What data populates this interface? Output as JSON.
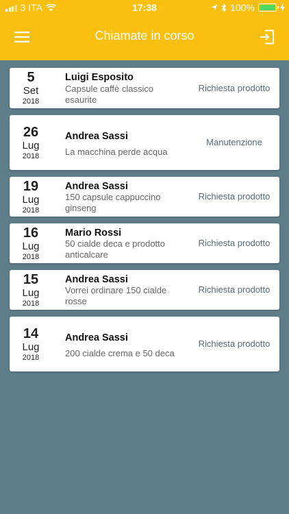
{
  "status_bar": {
    "carrier": "3 ITA",
    "time": "17:38",
    "battery": "100%"
  },
  "header": {
    "title": "Chiamate in corso",
    "menu_icon": "hamburger-menu-icon",
    "logout_icon": "logout-icon"
  },
  "colors": {
    "header": "#fbbf10",
    "background": "#5f7c89",
    "card": "#ffffff",
    "battery": "#4cd964"
  },
  "calls": [
    {
      "day": "5",
      "month": "Set",
      "year": "2018",
      "name": "Luigi Esposito",
      "description": "Capsule caffè classico esaurite",
      "type": "Richiesta prodotto"
    },
    {
      "day": "26",
      "month": "Lug",
      "year": "2018",
      "name": "Andrea Sassi",
      "description": "La macchina perde acqua",
      "type": "Manutenzione"
    },
    {
      "day": "19",
      "month": "Lug",
      "year": "2018",
      "name": "Andrea Sassi",
      "description": "150 capsule cappuccino ginseng",
      "type": "Richiesta prodotto"
    },
    {
      "day": "16",
      "month": "Lug",
      "year": "2018",
      "name": "Mario Rossi",
      "description": "50 cialde deca e prodotto anticalcare",
      "type": "Richiesta prodotto"
    },
    {
      "day": "15",
      "month": "Lug",
      "year": "2018",
      "name": "Andrea Sassi",
      "description": "Vorrei ordinare 150 cialde rosse",
      "type": "Richiesta prodotto"
    },
    {
      "day": "14",
      "month": "Lug",
      "year": "2018",
      "name": "Andrea Sassi",
      "description": "200 cialde crema e 50 deca",
      "type": "Richiesta prodotto"
    }
  ]
}
